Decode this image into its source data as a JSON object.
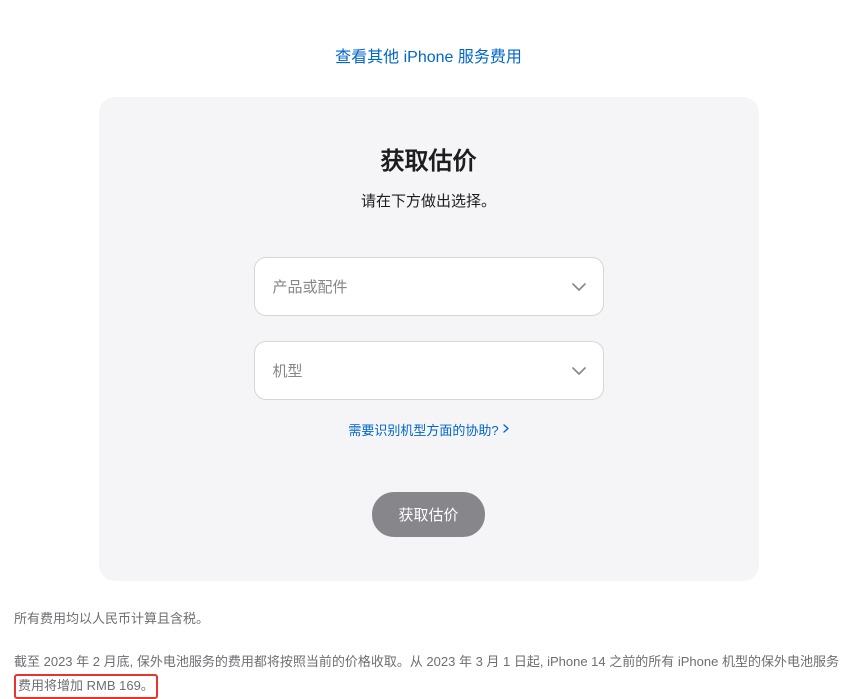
{
  "topLink": {
    "label": "查看其他 iPhone 服务费用"
  },
  "card": {
    "title": "获取估价",
    "subtitle": "请在下方做出选择。",
    "select1": {
      "placeholder": "产品或配件"
    },
    "select2": {
      "placeholder": "机型"
    },
    "helpLink": {
      "label": "需要识别机型方面的协助?"
    },
    "button": {
      "label": "获取估价"
    }
  },
  "footer": {
    "p1": "所有费用均以人民币计算且含税。",
    "p2_prefix": "截至 2023 年 2 月底, 保外电池服务的费用都将按照当前的价格收取。从 2023 年 3 月 1 日起, iPhone 14 之前的所有 iPhone 机型的保外电池服务",
    "p2_highlight": "费用将增加 RMB 169。"
  }
}
